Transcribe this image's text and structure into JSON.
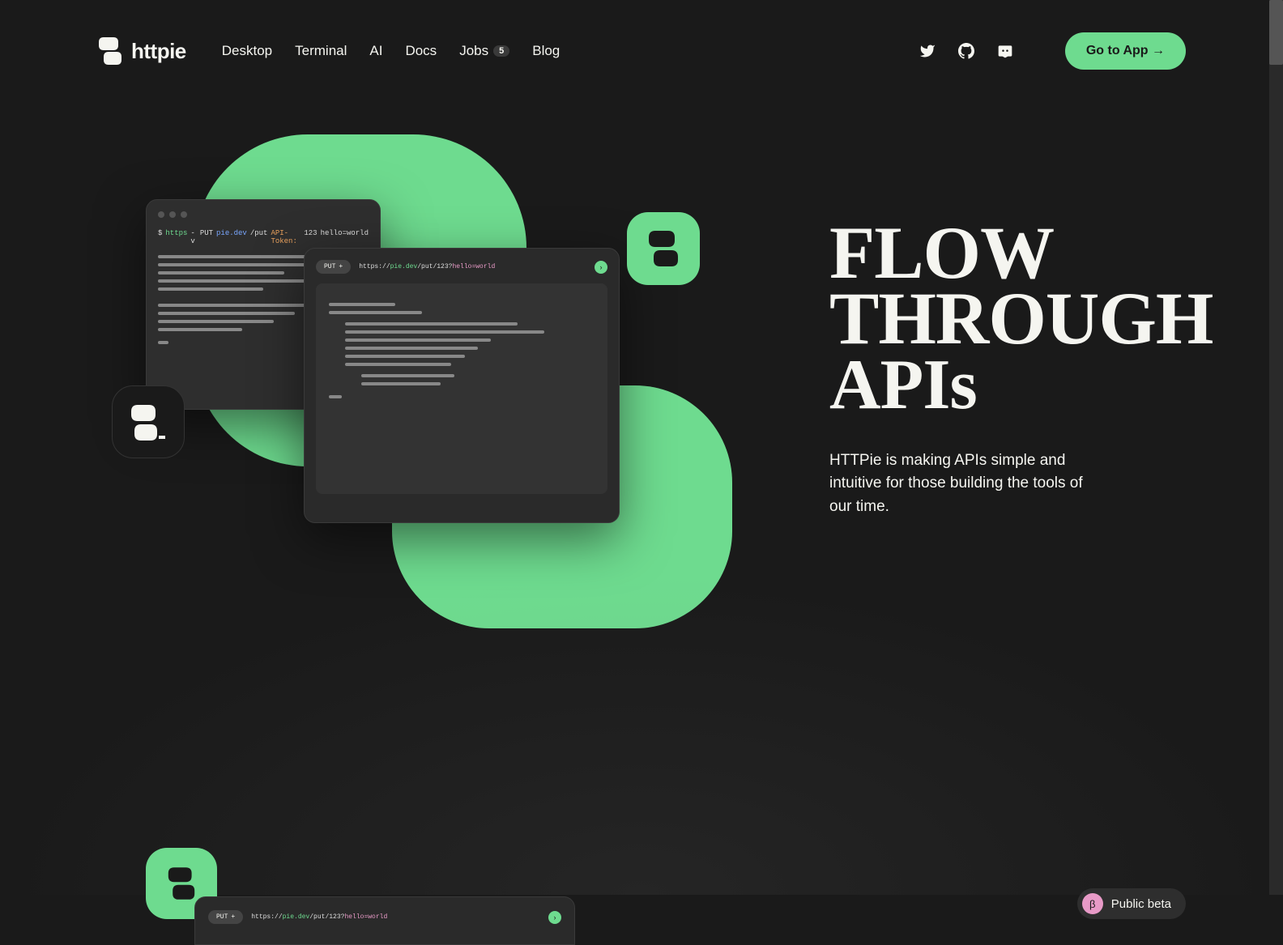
{
  "brand": {
    "name": "httpie"
  },
  "nav": {
    "desktop": "Desktop",
    "terminal": "Terminal",
    "ai": "AI",
    "docs": "Docs",
    "jobs": "Jobs",
    "jobs_count": "5",
    "blog": "Blog"
  },
  "cta": {
    "label": "Go to App →"
  },
  "hero": {
    "title_line1": "FLOW",
    "title_line2": "THROUGH",
    "title_line3": "APIs",
    "subtitle": "HTTPie is making APIs simple and intuitive for those building the tools of our time."
  },
  "illustration": {
    "terminal_cmd": {
      "prompt": "$",
      "cmd": "https",
      "flag": "-v",
      "method": "PUT",
      "host": "pie.dev",
      "path": "/put",
      "header_key": "API-Token:",
      "header_val": "123",
      "body": "hello=world"
    },
    "desktop": {
      "method": "PUT",
      "plus": "+",
      "protocol": "https://",
      "host": "pie.dev",
      "path": "/put/123?",
      "query": "hello=world"
    }
  },
  "section2": {
    "beta_symbol": "β",
    "beta_label": "Public beta",
    "desktop": {
      "method": "PUT",
      "plus": "+",
      "protocol": "https://",
      "host": "pie.dev",
      "path": "/put/123?",
      "query": "hello=world"
    }
  }
}
